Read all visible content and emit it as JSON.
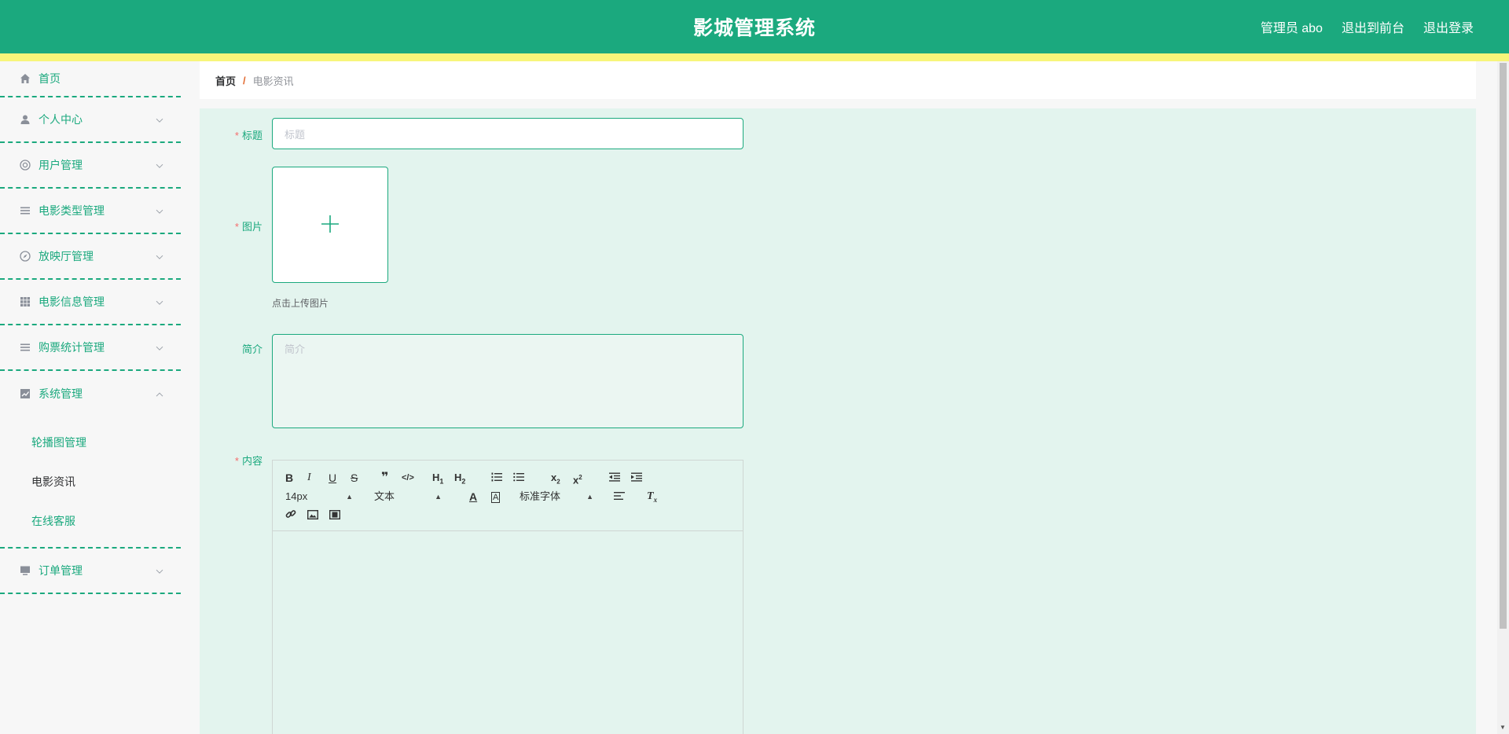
{
  "header": {
    "title": "影城管理系统",
    "links": [
      "管理员 abo",
      "退出到前台",
      "退出登录"
    ]
  },
  "sidebar": {
    "home": "首页",
    "menus": [
      {
        "label": "个人中心",
        "icon": "user-icon"
      },
      {
        "label": "用户管理",
        "icon": "lifebuoy-icon"
      },
      {
        "label": "电影类型管理",
        "icon": "list-icon"
      },
      {
        "label": "放映厅管理",
        "icon": "compass-icon"
      },
      {
        "label": "电影信息管理",
        "icon": "grid-icon"
      },
      {
        "label": "购票统计管理",
        "icon": "list-icon"
      },
      {
        "label": "系统管理",
        "icon": "chart-icon"
      }
    ],
    "system_sub": [
      "轮播图管理",
      "电影资讯",
      "在线客服"
    ],
    "order": {
      "label": "订单管理",
      "icon": "monitor-icon"
    }
  },
  "breadcrumb": {
    "home": "首页",
    "separator": "/",
    "current": "电影资讯"
  },
  "form": {
    "title_label": "标题",
    "title_placeholder": "标题",
    "image_label": "图片",
    "upload_tip": "点击上传图片",
    "intro_label": "简介",
    "intro_placeholder": "简介",
    "content_label": "内容"
  },
  "editor": {
    "font_size": "14px",
    "header_select": "文本",
    "font_family": "标准字体"
  },
  "colors": {
    "primary": "#1ba97e",
    "stripe": "#f7f57a",
    "required": "#f56c6c"
  }
}
